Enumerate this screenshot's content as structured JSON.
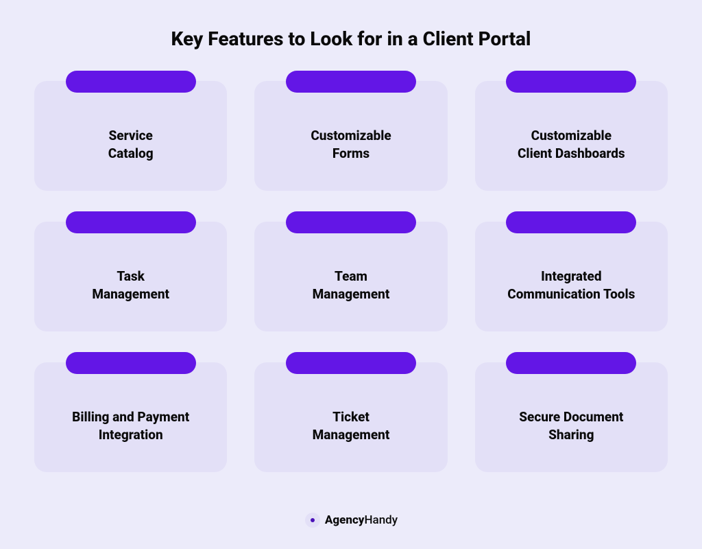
{
  "title": "Key Features to Look for in a Client Portal",
  "features": [
    {
      "line1": "Service",
      "line2": "Catalog"
    },
    {
      "line1": "Customizable",
      "line2": "Forms"
    },
    {
      "line1": "Customizable",
      "line2": "Client Dashboards"
    },
    {
      "line1": "Task",
      "line2": "Management"
    },
    {
      "line1": "Team",
      "line2": "Management"
    },
    {
      "line1": "Integrated",
      "line2": "Communication Tools"
    },
    {
      "line1": "Billing and Payment",
      "line2": "Integration"
    },
    {
      "line1": "Ticket",
      "line2": "Management"
    },
    {
      "line1": "Secure Document",
      "line2": "Sharing"
    }
  ],
  "brand": {
    "name_bold": "Agency",
    "name_light": "Handy"
  },
  "colors": {
    "background": "#ecebfa",
    "card": "#e3e0f7",
    "pill": "#6316e6",
    "text": "#0a0a0a"
  }
}
